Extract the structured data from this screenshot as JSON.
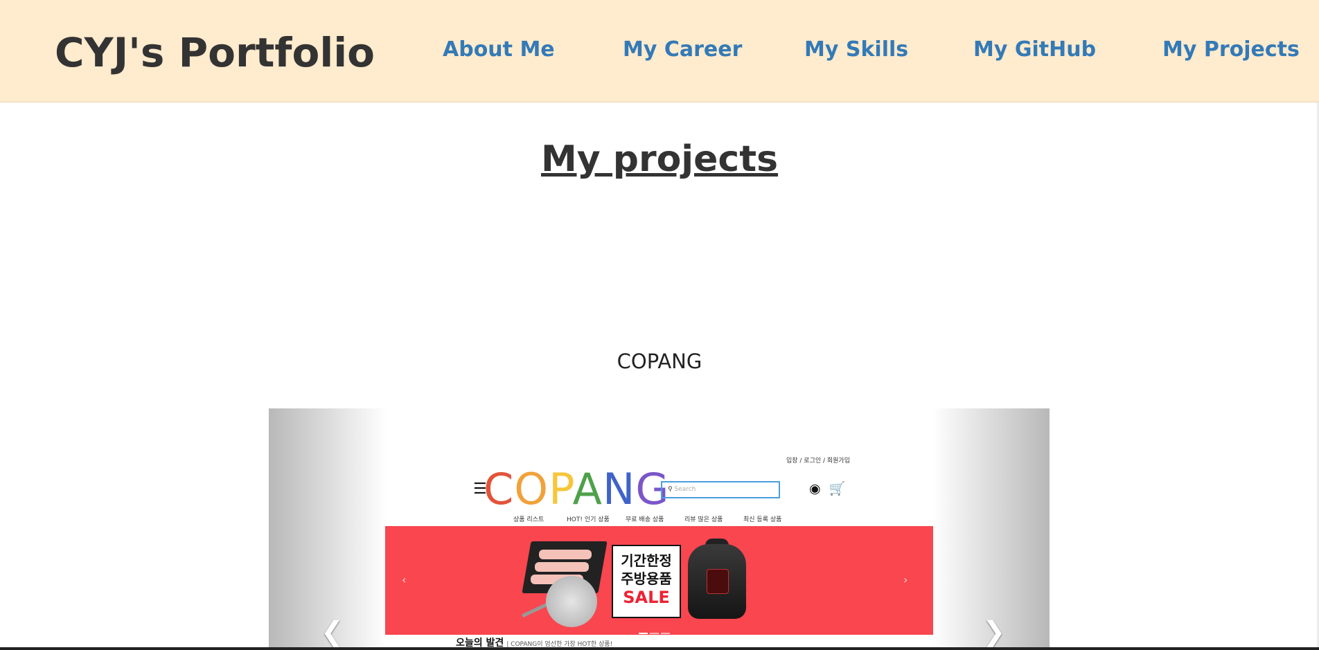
{
  "nav": {
    "brand": "CYJ's Portfolio",
    "items": [
      {
        "label": "About Me"
      },
      {
        "label": "My Career"
      },
      {
        "label": "My Skills"
      },
      {
        "label": "My GitHub"
      },
      {
        "label": "My Projects"
      }
    ]
  },
  "main": {
    "title": "My projects",
    "project": {
      "name": "COPANG",
      "screenshot": {
        "top_links": "입장 / 로그인 / 회원가입",
        "menu_icon": "☰",
        "logo_text": "COPANG",
        "logo_colors": [
          "#e2543a",
          "#f0a23a",
          "#f6c63a",
          "#4ea14a",
          "#3f63c9",
          "#7a56c9"
        ],
        "search_placeholder": "Search",
        "categories": [
          "상품 리스트",
          "HOT! 인기 상품",
          "무료 배송 상품",
          "리뷰 많은 상품",
          "최신 등록 상품"
        ],
        "banner": {
          "line1": "기간한정",
          "line2": "주방용품",
          "line3": "SALE",
          "bg_color": "#f9464f"
        },
        "today_title": "오늘의 발견",
        "today_sub": "| COPANG이 엄선한 가장 HOT한 상품!"
      }
    }
  },
  "icons": {
    "prev": "chevron-left-icon",
    "next": "chevron-right-icon",
    "user": "user-icon",
    "cart": "cart-icon"
  }
}
